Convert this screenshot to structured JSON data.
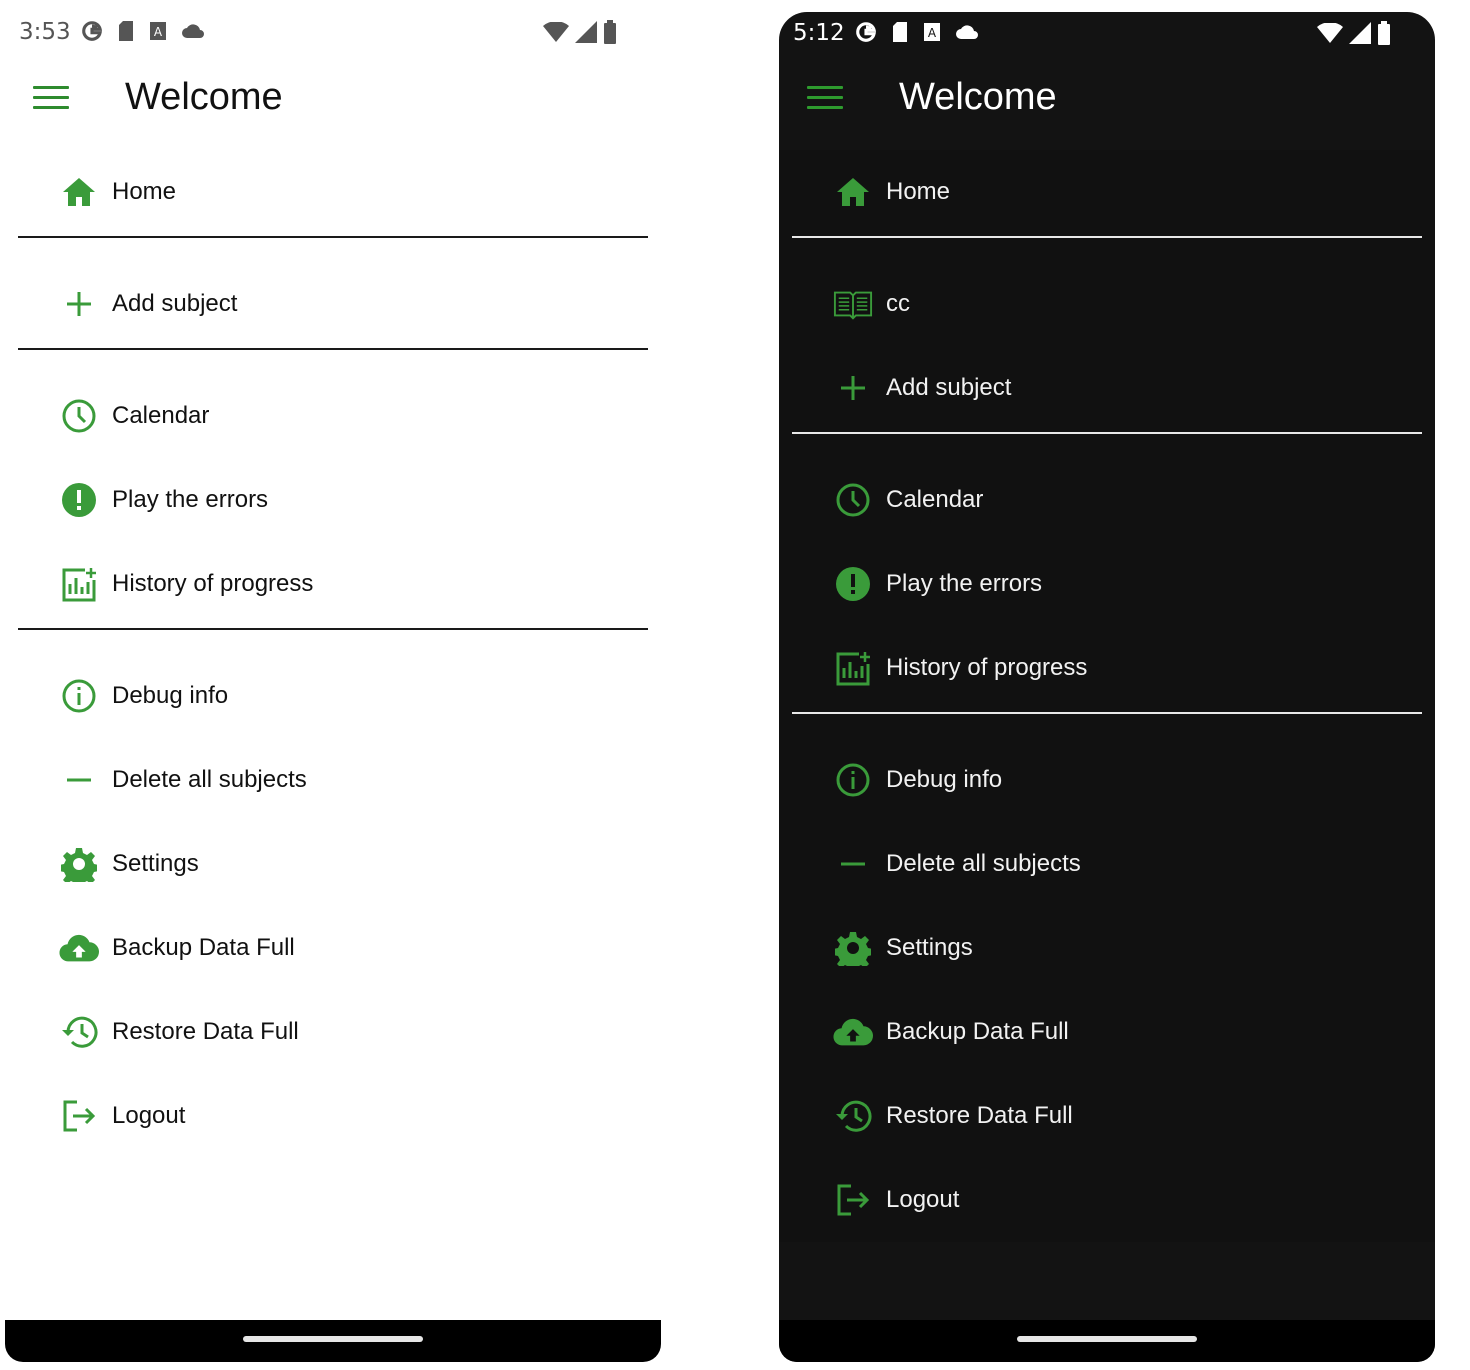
{
  "accent": "#3a9b3a",
  "phones": {
    "light": {
      "time": "3:53",
      "title": "Welcome",
      "home": "Home",
      "add_subject": "Add subject",
      "calendar": "Calendar",
      "play_errors": "Play the errors",
      "history": "History of progress",
      "debug": "Debug info",
      "delete_all": "Delete all subjects",
      "settings": "Settings",
      "backup": "Backup Data Full",
      "restore": "Restore Data Full",
      "logout": "Logout"
    },
    "dark": {
      "time": "5:12",
      "title": "Welcome",
      "home": "Home",
      "subject_cc": "cc",
      "add_subject": "Add subject",
      "calendar": "Calendar",
      "play_errors": "Play the errors",
      "history": "History of progress",
      "debug": "Debug info",
      "delete_all": "Delete all subjects",
      "settings": "Settings",
      "backup": "Backup Data Full",
      "restore": "Restore Data Full",
      "logout": "Logout"
    }
  }
}
